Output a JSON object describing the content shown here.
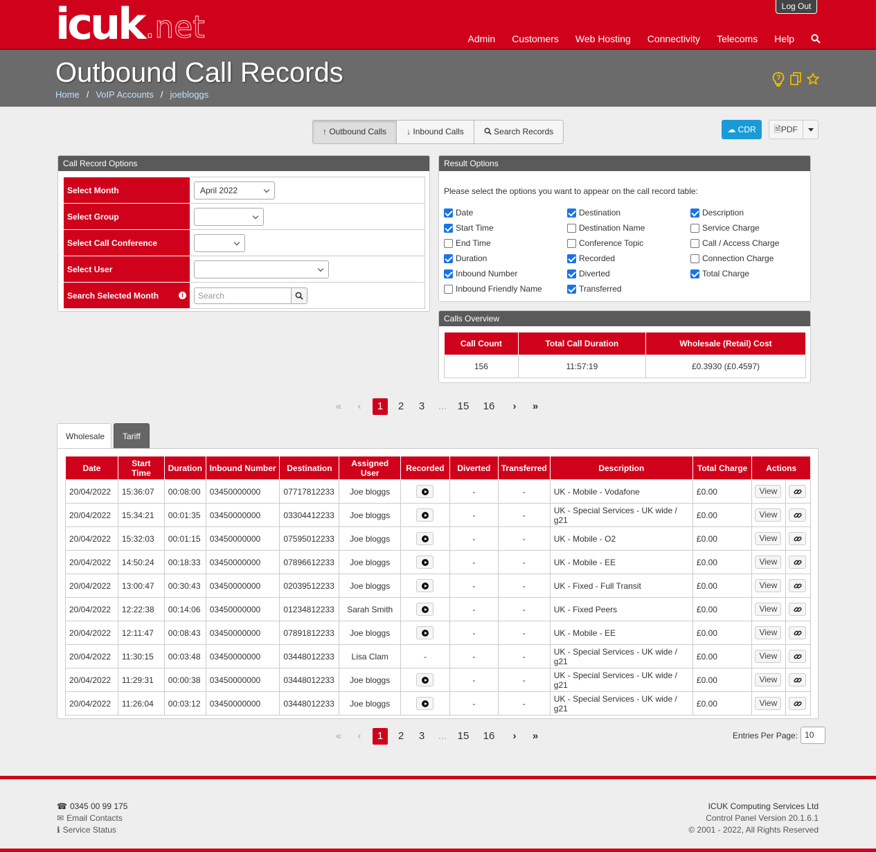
{
  "header": {
    "logo_main": "icuk",
    "logo_suffix": ".net",
    "logout_label": "Log Out",
    "nav": [
      "Admin",
      "Customers",
      "Web Hosting",
      "Connectivity",
      "Telecoms",
      "Help"
    ]
  },
  "title": {
    "text": "Outbound Call Records",
    "breadcrumb": [
      "Home",
      "VoIP Accounts",
      "joebloggs"
    ],
    "separator": "/"
  },
  "toolbar": {
    "tabs": [
      "Outbound Calls",
      "Inbound Calls",
      "Search Records"
    ],
    "cdr_label": "CDR",
    "pdf_label": "PDF"
  },
  "call_record_options": {
    "heading": "Call Record Options",
    "rows": [
      {
        "label": "Select Month",
        "value": "April 2022"
      },
      {
        "label": "Select Group",
        "value": ""
      },
      {
        "label": "Select Call Conference",
        "value": ""
      },
      {
        "label": "Select User",
        "value": ""
      },
      {
        "label": "Search Selected Month",
        "placeholder": "Search"
      }
    ],
    "info_glyph": "i"
  },
  "result_options": {
    "heading": "Result Options",
    "intro": "Please select the options you want to appear on the call record table:",
    "options": [
      {
        "label": "Date",
        "checked": true
      },
      {
        "label": "Destination",
        "checked": true
      },
      {
        "label": "Description",
        "checked": true
      },
      {
        "label": "Start Time",
        "checked": true
      },
      {
        "label": "Destination Name",
        "checked": false
      },
      {
        "label": "Service Charge",
        "checked": false
      },
      {
        "label": "End Time",
        "checked": false
      },
      {
        "label": "Conference Topic",
        "checked": false
      },
      {
        "label": "Call / Access Charge",
        "checked": false
      },
      {
        "label": "Duration",
        "checked": true
      },
      {
        "label": "Recorded",
        "checked": true
      },
      {
        "label": "Connection Charge",
        "checked": false
      },
      {
        "label": "Inbound Number",
        "checked": true
      },
      {
        "label": "Diverted",
        "checked": true
      },
      {
        "label": "Total Charge",
        "checked": true
      },
      {
        "label": "Inbound Friendly Name",
        "checked": false
      },
      {
        "label": "Transferred",
        "checked": true
      }
    ]
  },
  "calls_overview": {
    "heading": "Calls Overview",
    "headers": [
      "Call Count",
      "Total Call Duration",
      "Wholesale (Retail) Cost"
    ],
    "values": [
      "156",
      "11:57:19",
      "£0.3930 (£0.4597)"
    ]
  },
  "pagination": {
    "pages": [
      "1",
      "2",
      "3",
      "...",
      "15",
      "16"
    ],
    "current": "1"
  },
  "record_tabs": [
    "Wholesale",
    "Tariff"
  ],
  "records": {
    "headers": [
      "Date",
      "Start Time",
      "Duration",
      "Inbound Number",
      "Destination",
      "Assigned User",
      "Recorded",
      "Diverted",
      "Transferred",
      "Description",
      "Total Charge",
      "Actions"
    ],
    "view_label": "View",
    "rows": [
      {
        "date": "20/04/2022",
        "start": "15:36:07",
        "duration": "00:08:00",
        "inbound": "03450000000",
        "destination": "07717812233",
        "user": "Joe bloggs",
        "recorded": true,
        "diverted": "-",
        "transferred": "-",
        "description": "UK - Mobile - Vodafone",
        "charge": "£0.00"
      },
      {
        "date": "20/04/2022",
        "start": "15:34:21",
        "duration": "00:01:35",
        "inbound": "03450000000",
        "destination": "03304412233",
        "user": "Joe bloggs",
        "recorded": true,
        "diverted": "-",
        "transferred": "-",
        "description": "UK - Special Services - UK wide / g21",
        "charge": "£0.00"
      },
      {
        "date": "20/04/2022",
        "start": "15:32:03",
        "duration": "00:01:15",
        "inbound": "03450000000",
        "destination": "07595012233",
        "user": "Joe bloggs",
        "recorded": true,
        "diverted": "-",
        "transferred": "-",
        "description": "UK - Mobile - O2",
        "charge": "£0.00"
      },
      {
        "date": "20/04/2022",
        "start": "14:50:24",
        "duration": "00:18:33",
        "inbound": "03450000000",
        "destination": "07896612233",
        "user": "Joe bloggs",
        "recorded": true,
        "diverted": "-",
        "transferred": "-",
        "description": "UK - Mobile - EE",
        "charge": "£0.00"
      },
      {
        "date": "20/04/2022",
        "start": "13:00:47",
        "duration": "00:30:43",
        "inbound": "03450000000",
        "destination": "02039512233",
        "user": "Joe bloggs",
        "recorded": true,
        "diverted": "-",
        "transferred": "-",
        "description": "UK - Fixed - Full Transit",
        "charge": "£0.00"
      },
      {
        "date": "20/04/2022",
        "start": "12:22:38",
        "duration": "00:14:06",
        "inbound": "03450000000",
        "destination": "01234812233",
        "user": "Sarah Smith",
        "recorded": true,
        "diverted": "-",
        "transferred": "-",
        "description": "UK - Fixed Peers",
        "charge": "£0.00"
      },
      {
        "date": "20/04/2022",
        "start": "12:11:47",
        "duration": "00:08:43",
        "inbound": "03450000000",
        "destination": "07891812233",
        "user": "Joe bloggs",
        "recorded": true,
        "diverted": "-",
        "transferred": "-",
        "description": "UK - Mobile - EE",
        "charge": "£0.00"
      },
      {
        "date": "20/04/2022",
        "start": "11:30:15",
        "duration": "00:03:48",
        "inbound": "03450000000",
        "destination": "03448012233",
        "user": "Lisa Clam",
        "recorded": false,
        "recorded_text": "-",
        "diverted": "-",
        "transferred": "-",
        "description": "UK - Special Services - UK wide / g21",
        "charge": "£0.00"
      },
      {
        "date": "20/04/2022",
        "start": "11:29:31",
        "duration": "00:00:38",
        "inbound": "03450000000",
        "destination": "03448012233",
        "user": "Joe bloggs",
        "recorded": true,
        "diverted": "-",
        "transferred": "-",
        "description": "UK - Special Services - UK wide / g21",
        "charge": "£0.00"
      },
      {
        "date": "20/04/2022",
        "start": "11:26:04",
        "duration": "00:03:12",
        "inbound": "03450000000",
        "destination": "03448012233",
        "user": "Joe bloggs",
        "recorded": true,
        "diverted": "-",
        "transferred": "-",
        "description": "UK - Special Services - UK wide / g21",
        "charge": "£0.00"
      }
    ]
  },
  "entries_per_page": {
    "label": "Entries Per Page:",
    "value": "10"
  },
  "footer": {
    "phone": "0345 00 99 175",
    "email": "Email Contacts",
    "status": "Service Status",
    "company": "ICUK Computing Services Ltd",
    "version": "Control Panel Version 20.1.6.1",
    "copyright": "© 2001 - 2022, All Rights Reserved"
  },
  "colors": {
    "brand_red": "#d0021b",
    "title_bar": "#6b6b6b",
    "cdr_blue": "#1a9bd7",
    "link": "#bde0ff",
    "icon_gold": "#e6b800"
  }
}
